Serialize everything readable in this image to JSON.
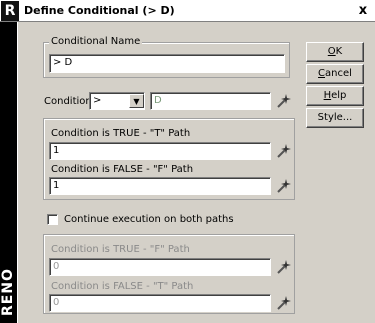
{
  "window": {
    "app_badge": "R",
    "title": "Define Conditional (> D)",
    "close_glyph": "x"
  },
  "brand": {
    "text": "RENO"
  },
  "conditional_name": {
    "group_label": "Conditional Name",
    "value": "> D"
  },
  "condition": {
    "label": "Condition",
    "operator": ">",
    "value": "D"
  },
  "true_path": {
    "label": "Condition is TRUE - \"T\" Path",
    "value": "1"
  },
  "false_path": {
    "label": "Condition is FALSE - \"F\" Path",
    "value": "1"
  },
  "continue_both": {
    "label": "Continue execution on both paths",
    "checked": false
  },
  "both_paths": {
    "true_label": "Condition is TRUE - \"F\" Path",
    "true_value": "0",
    "false_label": "Condition is FALSE - \"T\" Path",
    "false_value": "0"
  },
  "buttons": {
    "ok_hot": "O",
    "ok_rest": "K",
    "cancel_hot": "C",
    "cancel_rest": "ancel",
    "help_hot": "H",
    "help_rest": "elp",
    "style": "Style..."
  },
  "icons": {
    "wand": "magic-wand-icon",
    "dropdown": "chevron-down-icon"
  }
}
